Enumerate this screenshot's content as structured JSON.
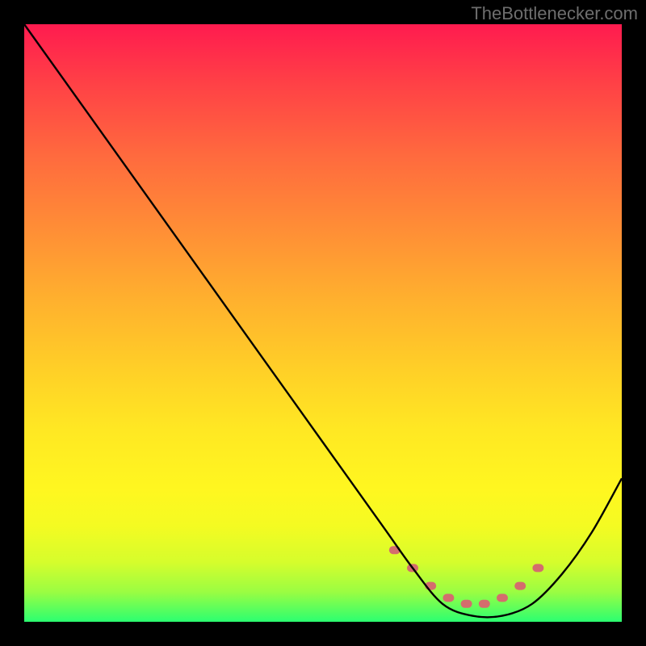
{
  "attribution": "TheBottlenecker.com",
  "chart_data": {
    "type": "line",
    "title": "",
    "xlabel": "",
    "ylabel": "",
    "xlim": [
      0,
      100
    ],
    "ylim": [
      0,
      100
    ],
    "series": [
      {
        "name": "bottleneck-curve",
        "x": [
          0,
          10,
          20,
          30,
          40,
          50,
          60,
          65,
          70,
          75,
          80,
          85,
          90,
          95,
          100
        ],
        "values": [
          100,
          86,
          72,
          58,
          44,
          30,
          16,
          9,
          3,
          1,
          1,
          3,
          8,
          15,
          24
        ]
      }
    ],
    "markers": {
      "name": "highlight-band",
      "color": "#d46d6d",
      "x": [
        62,
        65,
        68,
        71,
        74,
        77,
        80,
        83,
        86
      ],
      "values": [
        12,
        9,
        6,
        4,
        3,
        3,
        4,
        6,
        9
      ]
    },
    "gradient_stops": [
      {
        "pos": 0.0,
        "color": "#ff1b4f"
      },
      {
        "pos": 0.5,
        "color": "#ffb02e"
      },
      {
        "pos": 0.8,
        "color": "#fff720"
      },
      {
        "pos": 1.0,
        "color": "#2bff71"
      }
    ]
  }
}
